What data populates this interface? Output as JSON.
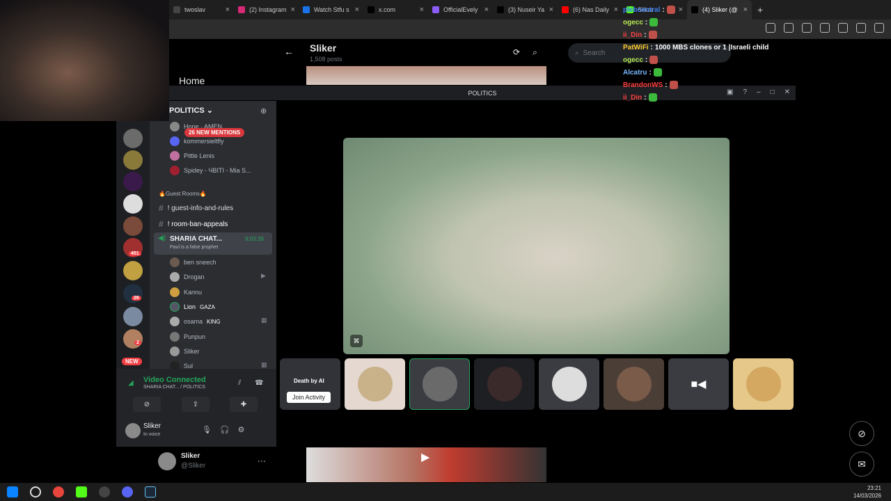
{
  "browser": {
    "tabs": [
      {
        "label": "twoslav",
        "color": "#444"
      },
      {
        "label": "(2) Instagram",
        "color": "#d62976"
      },
      {
        "label": "Watch Stfu s",
        "color": "#1a73e8"
      },
      {
        "label": "x.com",
        "color": "#000"
      },
      {
        "label": "OfficialEvely",
        "color": "#8b5cf6"
      },
      {
        "label": "(3) Nuseir Ya",
        "color": "#000"
      },
      {
        "label": "(6) Nas Daily",
        "color": "#ff0000"
      },
      {
        "label": "Sliker",
        "color": "#53fc18"
      },
      {
        "label": "(4) Sliker (@",
        "color": "#000"
      }
    ],
    "new_tab": "+",
    "close_glyph": "×"
  },
  "twitter": {
    "nav_home": "Home",
    "profile_name": "Sliker",
    "post_count": "1,508 posts",
    "search_placeholder": "Search",
    "post_user": "Sliker",
    "post_handle": "@Sliker",
    "back_glyph": "←",
    "more_glyph": "···"
  },
  "twitch_chat": [
    {
      "user": "plebcentral",
      "user_color": "#3b82f6",
      "msg": ""
    },
    {
      "user": "ogecc",
      "user_color": "#b5e853",
      "msg": ""
    },
    {
      "user": "ii_Din",
      "user_color": "#ff4040",
      "msg": ""
    },
    {
      "user": "PatWiFi",
      "user_color": "#ffcc33",
      "msg": "1000 MBS clones or 1 |Israeli child"
    },
    {
      "user": "ogecc",
      "user_color": "#b5e853",
      "msg": ""
    },
    {
      "user": "Alcatru",
      "user_color": "#7ab8ff",
      "msg": ""
    },
    {
      "user": "BrandonWS",
      "user_color": "#ff4040",
      "msg": ""
    },
    {
      "user": "ii_Din",
      "user_color": "#ff4040",
      "msg": ""
    }
  ],
  "discord": {
    "window_title": "POLITICS",
    "server_name": "POLITICS",
    "mentions": "26 NEW MENTIONS",
    "server_badges": {
      "s1": "451",
      "s2": "26",
      "s3": "2",
      "new": "NEW"
    },
    "top_users": [
      {
        "name": "Hope · AMEN"
      },
      {
        "name": "kommersieltfly"
      },
      {
        "name": "Pittle Lenis"
      },
      {
        "name": "Spidey - ЧВІТІ - Mia S..."
      }
    ],
    "category": "🔥Guest Rooms🔥",
    "text_channels": [
      {
        "name": "! guest-info-and-rules"
      },
      {
        "name": "! room-ban-appeals"
      }
    ],
    "voice_channel": {
      "name": "SHARIA CHAT...",
      "status": "Paul is a false prophet",
      "duration": "9:03:39"
    },
    "voice_members": [
      {
        "name": "ben sneech",
        "tag": ""
      },
      {
        "name": "Drogan",
        "tag": ""
      },
      {
        "name": "Kannu",
        "tag": ""
      },
      {
        "name": "Lion",
        "tag": "GAZA"
      },
      {
        "name": "osama",
        "tag": "KING"
      },
      {
        "name": "Punpun",
        "tag": ""
      },
      {
        "name": "Sliker",
        "tag": ""
      },
      {
        "name": "Sul",
        "tag": ""
      }
    ],
    "voice_panel": {
      "status": "Video Connected",
      "location": "SHARIA CHAT... / POLITICS"
    },
    "user_panel": {
      "name": "Sliker",
      "status": "In voice"
    },
    "tiles": {
      "activity_label": "Death by AI",
      "join_button": "Join Activity"
    }
  },
  "taskbar": {
    "time": "23:21",
    "date": "14/03/2026"
  }
}
